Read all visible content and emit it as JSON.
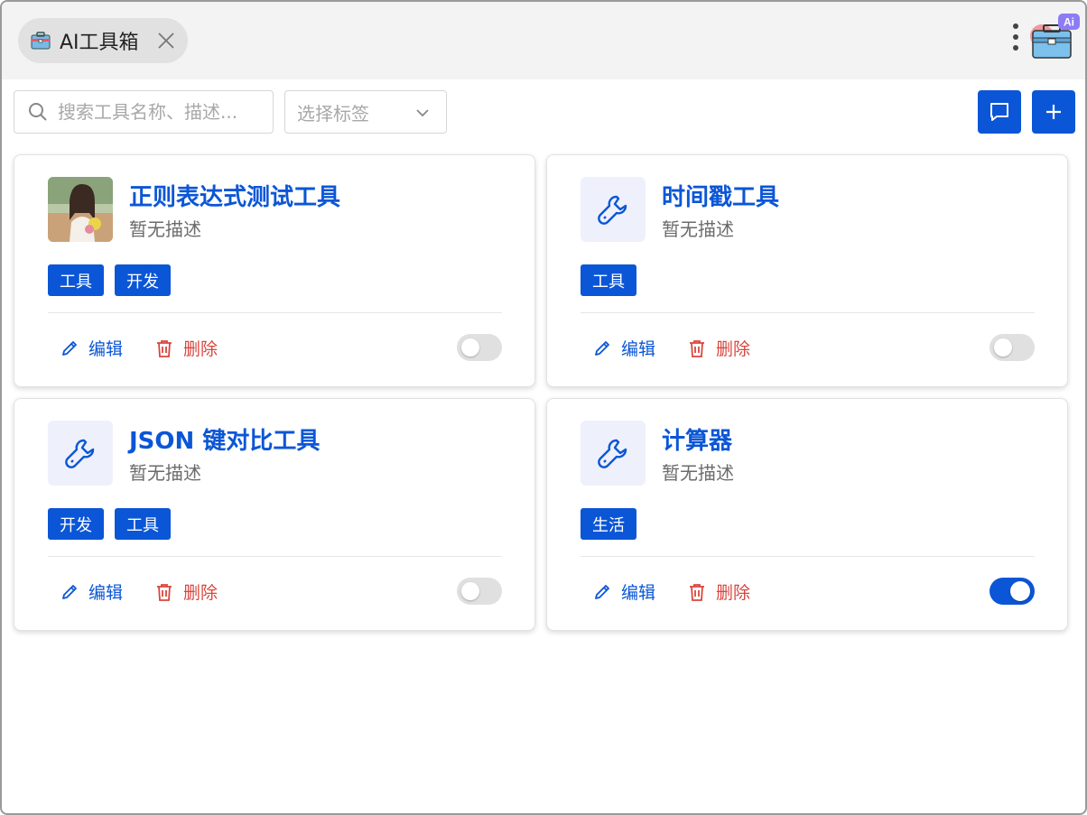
{
  "window": {
    "tab": {
      "label": "AI工具箱",
      "icon": "toolbox-icon"
    },
    "logo_badge": "Ai"
  },
  "toolbar": {
    "search_placeholder": "搜索工具名称、描述...",
    "tag_select_placeholder": "选择标签"
  },
  "colors": {
    "accent": "#0b56d6",
    "danger": "#d9453d",
    "muted": "#6b6b6b"
  },
  "tools": [
    {
      "name": "正则表达式测试工具",
      "desc": "暂无描述",
      "tags": [
        "工具",
        "开发"
      ],
      "enabled": false,
      "thumb": "photo-thumbnail"
    },
    {
      "name": "时间戳工具",
      "desc": "暂无描述",
      "tags": [
        "工具"
      ],
      "enabled": false,
      "thumb": "wrench-icon"
    },
    {
      "name": "JSON 键对比工具",
      "desc": "暂无描述",
      "tags": [
        "开发",
        "工具"
      ],
      "enabled": false,
      "thumb": "wrench-icon"
    },
    {
      "name": "计算器",
      "desc": "暂无描述",
      "tags": [
        "生活"
      ],
      "enabled": true,
      "thumb": "wrench-icon"
    }
  ],
  "actions": {
    "edit": "编辑",
    "delete": "删除"
  }
}
